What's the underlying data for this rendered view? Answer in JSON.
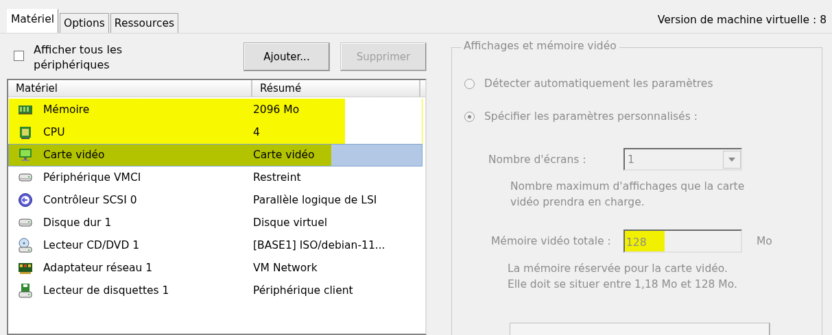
{
  "tabs": [
    {
      "label": "Matériel",
      "selected": true
    },
    {
      "label": "Options",
      "selected": false
    },
    {
      "label": "Ressources",
      "selected": false
    }
  ],
  "version_label": "Version de machine virtuelle : 8",
  "show_all_devices": {
    "label": "Afficher tous les périphériques",
    "checked": false
  },
  "buttons": [
    {
      "label": "Ajouter...",
      "disabled": false
    },
    {
      "label": "Supprimer",
      "disabled": true
    }
  ],
  "table": {
    "columns": [
      "Matériel",
      "Résumé"
    ],
    "rows": [
      {
        "kind": "memory",
        "name": "Mémoire",
        "summary": "2096 Mo",
        "selected": false,
        "highlighted": true
      },
      {
        "kind": "cpu",
        "name": "CPU",
        "summary": "4",
        "selected": false,
        "highlighted": true
      },
      {
        "kind": "video",
        "name": "Carte vidéo",
        "summary": "Carte vidéo",
        "selected": true,
        "highlighted": true
      },
      {
        "kind": "device",
        "name": "Périphérique VMCI",
        "summary": "Restreint",
        "selected": false,
        "highlighted": false
      },
      {
        "kind": "scsi",
        "name": "Contrôleur SCSI 0",
        "summary": "Parallèle logique de LSI",
        "selected": false,
        "highlighted": false
      },
      {
        "kind": "device",
        "name": "Disque dur 1",
        "summary": "Disque virtuel",
        "selected": false,
        "highlighted": false
      },
      {
        "kind": "cdrom",
        "name": "Lecteur CD/DVD 1",
        "summary": "[BASE1] ISO/debian-11...",
        "selected": false,
        "highlighted": false
      },
      {
        "kind": "network",
        "name": "Adaptateur réseau 1",
        "summary": "VM Network",
        "selected": false,
        "highlighted": false
      },
      {
        "kind": "floppy",
        "name": "Lecteur de disquettes 1",
        "summary": "Périphérique client",
        "selected": false,
        "highlighted": false
      }
    ]
  },
  "display_group": {
    "title": "Affichages et mémoire vidéo",
    "disabled": true,
    "modes": [
      {
        "label": "Détecter automatiquement les paramètres",
        "selected": false
      },
      {
        "label": "Spécifier les paramètres personnalisés :",
        "selected": true
      }
    ],
    "screens": {
      "label": "Nombre d'écrans :",
      "value": "1",
      "hint": "Nombre maximum d'affichages que la carte vidéo prendra en charge."
    },
    "memory": {
      "label": "Mémoire vidéo totale :",
      "value": "128",
      "unit": "Mo",
      "highlighted": true,
      "hint": "La mémoire réservée pour la carte vidéo. Elle doit se situer entre 1,18 Mo et 128 Mo."
    }
  }
}
